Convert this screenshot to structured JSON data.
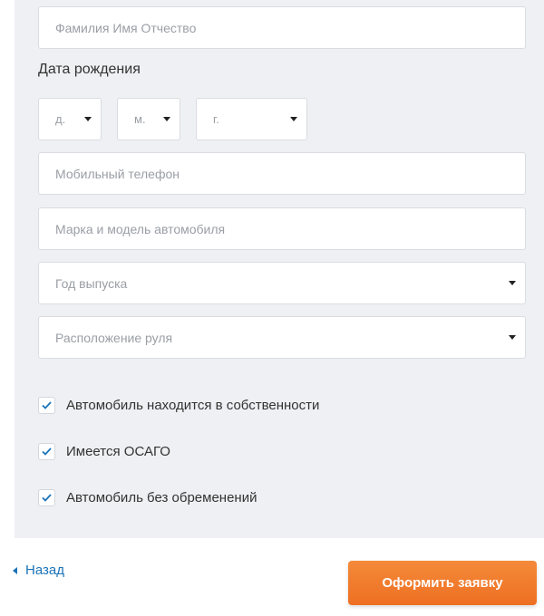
{
  "form": {
    "full_name_placeholder": "Фамилия Имя Отчество",
    "dob_label": "Дата рождения",
    "dob_day": "д.",
    "dob_month": "м.",
    "dob_year": "г.",
    "phone_placeholder": "Мобильный телефон",
    "car_model_placeholder": "Марка и модель автомобиля",
    "year_select": "Год выпуска",
    "steering_select": "Расположение руля"
  },
  "checks": [
    {
      "label": "Автомобиль находится в собственности",
      "checked": true
    },
    {
      "label": "Имеется ОСАГО",
      "checked": true
    },
    {
      "label": "Автомобиль без обременений",
      "checked": true
    }
  ],
  "footer": {
    "back_label": "Назад",
    "submit_label": "Оформить заявку"
  },
  "colors": {
    "accent": "#ee6f22",
    "link": "#1a73b8",
    "check": "#1a73b8",
    "panel": "#eef0f3"
  }
}
